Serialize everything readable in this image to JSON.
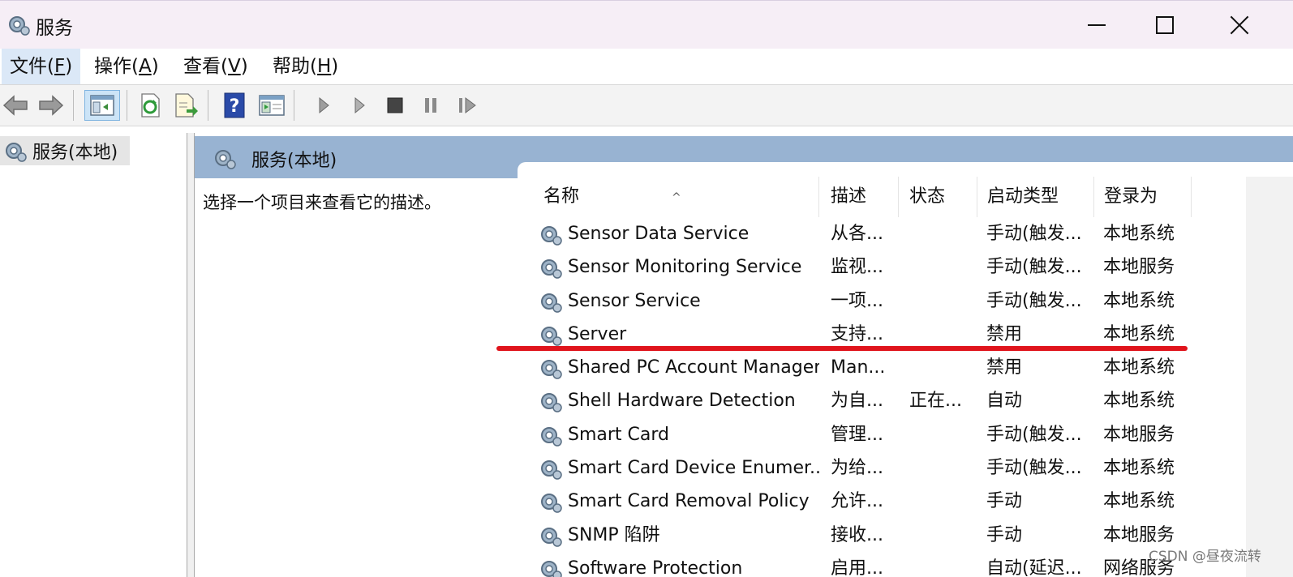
{
  "window": {
    "title": "服务",
    "controls": {
      "minimize": "minimize-icon",
      "maximize": "maximize-icon",
      "close": "close-icon"
    }
  },
  "menu": {
    "items": [
      {
        "label": "文件(",
        "key": "F",
        "suffix": ")"
      },
      {
        "label": "操作(",
        "key": "A",
        "suffix": ")"
      },
      {
        "label": "查看(",
        "key": "V",
        "suffix": ")"
      },
      {
        "label": "帮助(",
        "key": "H",
        "suffix": ")"
      }
    ]
  },
  "toolbar": {
    "icons": [
      "back-arrow-icon",
      "forward-arrow-icon",
      "show-hide-console-tree-icon",
      "refresh-icon",
      "export-list-icon",
      "help-icon",
      "properties-view-icon",
      "start-service-icon",
      "start-service-alt-icon",
      "stop-service-icon",
      "pause-service-icon",
      "restart-service-icon"
    ]
  },
  "tree": {
    "root_label": "服务(本地)"
  },
  "pane": {
    "header_label": "服务(本地)",
    "description": "选择一个项目来查看它的描述。"
  },
  "columns": {
    "name": "名称",
    "desc": "描述",
    "status": "状态",
    "startup": "启动类型",
    "logon": "登录为"
  },
  "services": [
    {
      "name": "Sensor Data Service",
      "desc": "从各...",
      "status": "",
      "startup": "手动(触发...",
      "logon": "本地系统"
    },
    {
      "name": "Sensor Monitoring Service",
      "desc": "监视...",
      "status": "",
      "startup": "手动(触发...",
      "logon": "本地服务"
    },
    {
      "name": "Sensor Service",
      "desc": "一项...",
      "status": "",
      "startup": "手动(触发...",
      "logon": "本地系统"
    },
    {
      "name": "Server",
      "desc": "支持...",
      "status": "",
      "startup": "禁用",
      "logon": "本地系统"
    },
    {
      "name": "Shared PC Account Manager",
      "desc": "Man...",
      "status": "",
      "startup": "禁用",
      "logon": "本地系统"
    },
    {
      "name": "Shell Hardware Detection",
      "desc": "为自...",
      "status": "正在...",
      "startup": "自动",
      "logon": "本地系统"
    },
    {
      "name": "Smart Card",
      "desc": "管理...",
      "status": "",
      "startup": "手动(触发...",
      "logon": "本地服务"
    },
    {
      "name": "Smart Card Device Enumer...",
      "desc": "为给...",
      "status": "",
      "startup": "手动(触发...",
      "logon": "本地系统"
    },
    {
      "name": "Smart Card Removal Policy",
      "desc": "允许...",
      "status": "",
      "startup": "手动",
      "logon": "本地系统"
    },
    {
      "name": "SNMP 陷阱",
      "desc": "接收...",
      "status": "",
      "startup": "手动",
      "logon": "本地服务"
    },
    {
      "name": "Software Protection",
      "desc": "启用...",
      "status": "",
      "startup": "自动(延迟...",
      "logon": "网络服务"
    }
  ],
  "highlight_color": "#e0141c",
  "watermark": "CSDN @昼夜流转"
}
